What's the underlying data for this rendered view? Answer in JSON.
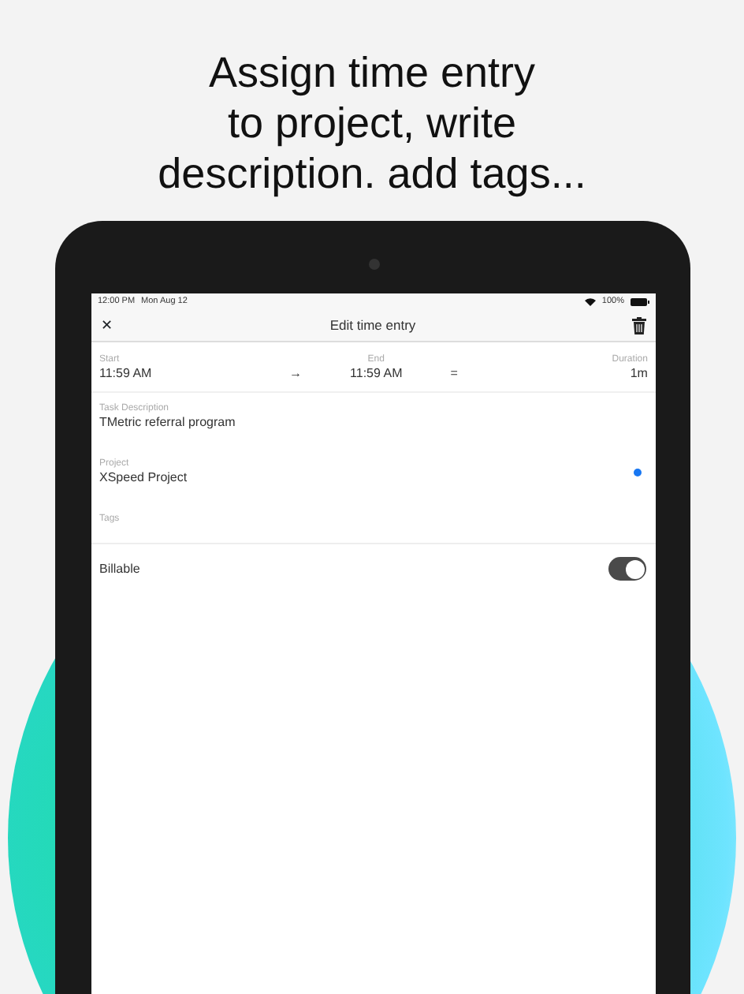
{
  "headline": [
    "Assign time entry",
    "to project, write",
    "description. add tags..."
  ],
  "status_bar": {
    "time": "12:00 PM",
    "date": "Mon Aug 12",
    "battery": "100%"
  },
  "nav": {
    "title": "Edit time entry",
    "close": "✕"
  },
  "times": {
    "start_label": "Start",
    "start": "11:59 AM",
    "arrow": "→",
    "end_label": "End",
    "end": "11:59 AM",
    "equals": "=",
    "duration_label": "Duration",
    "duration": "1m"
  },
  "fields": [
    {
      "label": "Task Description",
      "value": "TMetric referral program"
    },
    {
      "label": "Project",
      "value": "XSpeed Project",
      "color": "#1877f2"
    },
    {
      "label": "Tags"
    }
  ],
  "billable": {
    "label": "Billable",
    "on": true
  }
}
